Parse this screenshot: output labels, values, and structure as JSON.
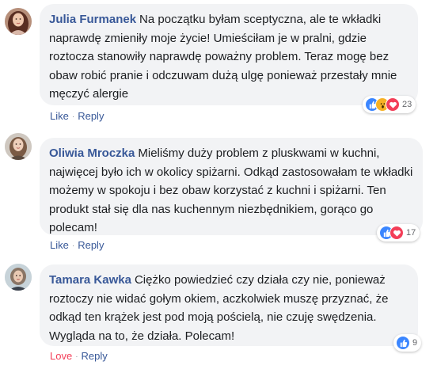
{
  "comments": [
    {
      "author": "Julia Furmanek",
      "text": "Na początku byłam sceptyczna, ale te wkładki naprawdę zmieniły moje życie! Umieściłam je w pralni, gdzie roztocza stanowiły naprawdę poważny problem. Teraz mogę bez obaw robić pranie i odczuwam dużą ulgę ponieważ przestały mnie męczyć alergie",
      "action_1": "Like",
      "action_2": "Reply",
      "reaction_count": "23",
      "reaction_icons": [
        "like-icon",
        "wow-icon",
        "love-icon"
      ]
    },
    {
      "author": "Oliwia Mroczka",
      "text": "Mieliśmy duży problem z pluskwami w kuchni, najwięcej było ich w okolicy spiżarni. Odkąd zastosowałam te wkładki możemy w spokoju i bez obaw korzystać z kuchni i spiżarni. Ten produkt stał się dla nas kuchennym niezbędnikiem, gorąco go polecam!",
      "action_1": "Like",
      "action_2": "Reply",
      "reaction_count": "17",
      "reaction_icons": [
        "like-icon",
        "love-icon"
      ]
    },
    {
      "author": "Tamara Kawka",
      "text": "Ciężko powiedzieć czy działa czy nie, ponieważ roztoczy nie widać gołym okiem, aczkolwiek muszę przyznać, że odkąd ten krążek jest pod moją pościelą, nie czuję swędzenia. Wygląda na to, że działa. Polecam!",
      "action_1": "Love",
      "action_2": "Reply",
      "reaction_count": "9",
      "reaction_icons": [
        "like-icon"
      ]
    }
  ],
  "separator": "·",
  "colors": {
    "link": "#385898",
    "love": "#f33e58",
    "bubble": "#f2f3f5",
    "like": "#3b86ff",
    "wow": "#f7b125"
  }
}
